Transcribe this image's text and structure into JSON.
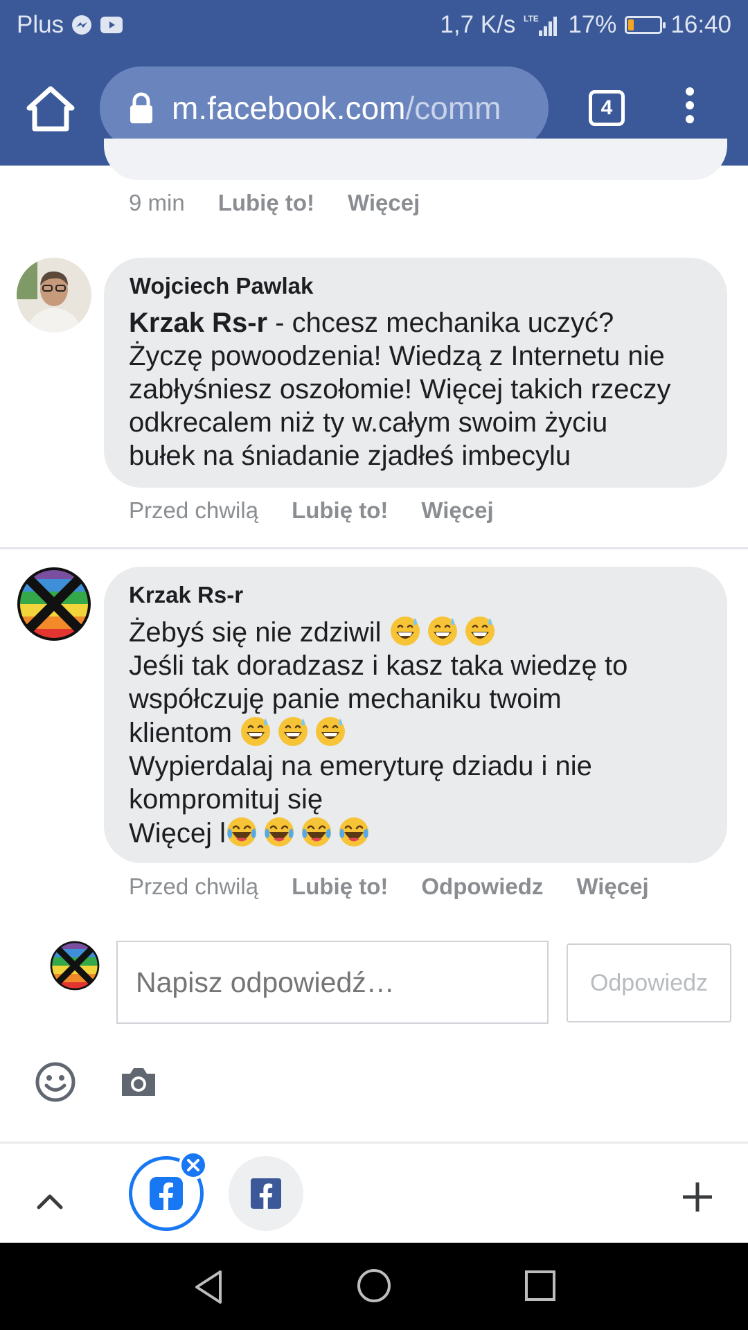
{
  "status_bar": {
    "carrier": "Plus",
    "speed": "1,7 K/s",
    "network": "LTE",
    "battery_percent": "17%",
    "battery_level": 0.17,
    "time": "16:40"
  },
  "browser": {
    "url_host": "m.facebook.com",
    "url_path": "/comm",
    "tab_count": "4"
  },
  "colors": {
    "header": "#3b5998",
    "bubble": "#eaebed",
    "accent": "#1877f2"
  },
  "previous_comment_meta": {
    "time": "9 min",
    "like": "Lubię to!",
    "more": "Więcej"
  },
  "comments": [
    {
      "author": "Wojciech Pawlak",
      "mention": "Krzak Rs-r",
      "lines": [
        " - chcesz mechanika uczyć?",
        "Życzę powoodzenia! Wiedzą z Internetu nie",
        "zabłyśniesz oszołomie! Więcej takich rzeczy",
        "odkrecalem niż ty w.całym swoim życiu",
        "bułek na śniadanie zjadłeś imbecylu"
      ],
      "time": "Przed chwilą",
      "like": "Lubię to!",
      "more": "Więcej"
    },
    {
      "author": "Krzak Rs-r",
      "lines": [
        "Żebyś się nie zdziwil ",
        "Jeśli tak doradzasz i kasz taka wiedzę to",
        "współczuję panie mechaniku twoim",
        "klientom ",
        "Wypierdalaj na emeryturę dziadu i nie",
        "kompromituj się",
        "Więcej l"
      ],
      "emoji_sweat": "grinning-sweat-emoji",
      "emoji_laugh": "tears-of-joy-emoji",
      "time": "Przed chwilą",
      "like": "Lubię to!",
      "reply": "Odpowiedz",
      "more": "Więcej"
    }
  ],
  "composer": {
    "placeholder": "Napisz odpowiedź…",
    "submit": "Odpowiedz"
  },
  "icons": {
    "home": "home-icon",
    "lock": "lock-icon",
    "menu": "more-vertical-icon",
    "emoji": "emoji-icon",
    "camera": "camera-icon",
    "chevron": "chevron-up-icon",
    "plus": "plus-icon"
  }
}
